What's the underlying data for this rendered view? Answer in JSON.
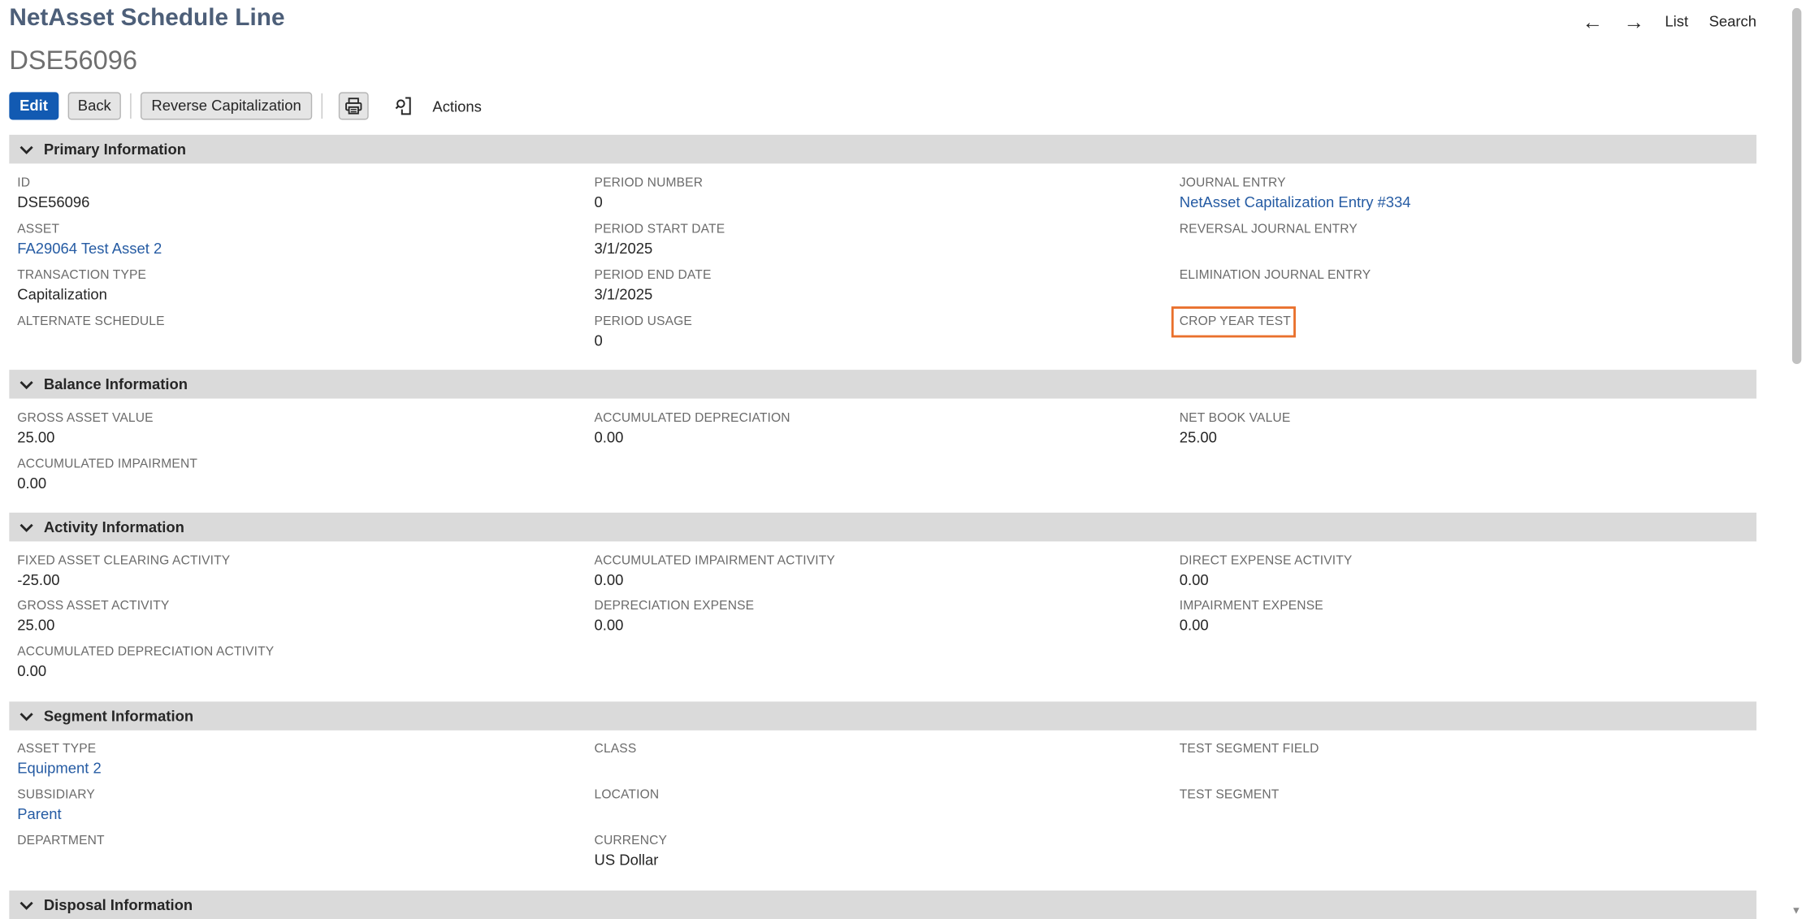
{
  "header": {
    "title": "NetAsset Schedule Line",
    "record_id": "DSE56096"
  },
  "topnav": {
    "list": "List",
    "search": "Search"
  },
  "toolbar": {
    "edit": "Edit",
    "back": "Back",
    "reverse": "Reverse Capitalization",
    "actions": "Actions"
  },
  "sections": {
    "primary": "Primary Information",
    "balance": "Balance Information",
    "activity": "Activity Information",
    "segment": "Segment Information",
    "disposal": "Disposal Information"
  },
  "primary": {
    "id_label": "ID",
    "id_value": "DSE56096",
    "asset_label": "ASSET",
    "asset_value": "FA29064 Test Asset 2",
    "txn_type_label": "TRANSACTION TYPE",
    "txn_type_value": "Capitalization",
    "alt_schedule_label": "ALTERNATE SCHEDULE",
    "period_number_label": "PERIOD NUMBER",
    "period_number_value": "0",
    "period_start_label": "PERIOD START DATE",
    "period_start_value": "3/1/2025",
    "period_end_label": "PERIOD END DATE",
    "period_end_value": "3/1/2025",
    "period_usage_label": "PERIOD USAGE",
    "period_usage_value": "0",
    "journal_entry_label": "JOURNAL ENTRY",
    "journal_entry_value": "NetAsset Capitalization Entry #334",
    "reversal_je_label": "REVERSAL JOURNAL ENTRY",
    "elimination_je_label": "ELIMINATION JOURNAL ENTRY",
    "crop_year_label": "CROP YEAR TEST"
  },
  "balance": {
    "gross_label": "GROSS ASSET VALUE",
    "gross_value": "25.00",
    "acc_impair_label": "ACCUMULATED IMPAIRMENT",
    "acc_impair_value": "0.00",
    "acc_dep_label": "ACCUMULATED DEPRECIATION",
    "acc_dep_value": "0.00",
    "nbv_label": "NET BOOK VALUE",
    "nbv_value": "25.00"
  },
  "activity": {
    "fa_clearing_label": "FIXED ASSET CLEARING ACTIVITY",
    "fa_clearing_value": "-25.00",
    "gross_act_label": "GROSS ASSET ACTIVITY",
    "gross_act_value": "25.00",
    "acc_dep_act_label": "ACCUMULATED DEPRECIATION ACTIVITY",
    "acc_dep_act_value": "0.00",
    "acc_impair_act_label": "ACCUMULATED IMPAIRMENT ACTIVITY",
    "acc_impair_act_value": "0.00",
    "dep_expense_label": "DEPRECIATION EXPENSE",
    "dep_expense_value": "0.00",
    "direct_exp_label": "DIRECT EXPENSE ACTIVITY",
    "direct_exp_value": "0.00",
    "impair_exp_label": "IMPAIRMENT EXPENSE",
    "impair_exp_value": "0.00"
  },
  "segment": {
    "asset_type_label": "ASSET TYPE",
    "asset_type_value": "Equipment 2",
    "subsidiary_label": "SUBSIDIARY",
    "subsidiary_value": "Parent",
    "department_label": "DEPARTMENT",
    "class_label": "CLASS",
    "location_label": "LOCATION",
    "currency_label": "CURRENCY",
    "currency_value": "US Dollar",
    "test_seg_field_label": "TEST SEGMENT FIELD",
    "test_seg_label": "TEST SEGMENT"
  },
  "colors": {
    "title": "#4d5f79",
    "link": "#255ba3",
    "primary_button": "#125ab2",
    "section_bar": "#dadada",
    "highlight": "#e9702c"
  },
  "icons": [
    "arrow-left-icon",
    "arrow-right-icon",
    "printer-icon",
    "document-search-icon",
    "chevron-down-icon"
  ]
}
